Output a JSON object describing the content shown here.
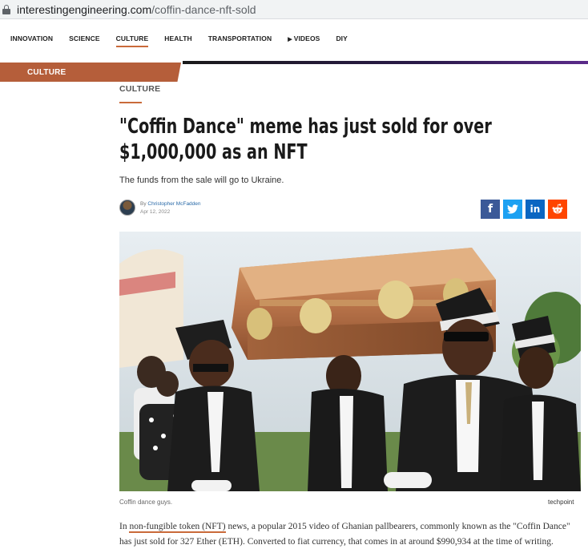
{
  "browser": {
    "url_domain": "interestingengineering.com",
    "url_path": "/coffin-dance-nft-sold"
  },
  "nav": {
    "items": [
      "INNOVATION",
      "SCIENCE",
      "CULTURE",
      "HEALTH",
      "TRANSPORTATION",
      "VIDEOS",
      "DIY"
    ],
    "active": "CULTURE"
  },
  "banner": {
    "label": "CULTURE"
  },
  "article": {
    "category": "CULTURE",
    "headline": "\"Coffin Dance\" meme has just sold for over $1,000,000 as an NFT",
    "subheadline": "The funds from the sale will go to Ukraine.",
    "by_prefix": "By",
    "author": "Christopher McFadden",
    "date": "Apr 12, 2022",
    "image_caption": "Coffin dance guys.",
    "image_credit": "techpoint",
    "body_before_link": "In ",
    "body_link": "non-fungible token (NFT)",
    "body_after_link": " news, a popular 2015 video of Ghanian pallbearers, commonly known as the \"Coffin Dance\" has just sold for 327 Ether (ETH). Converted to fiat currency, that comes in at around $990,934 at the time of writing."
  },
  "share": {
    "icons": [
      "facebook-icon",
      "twitter-icon",
      "linkedin-icon",
      "reddit-icon"
    ],
    "colors": {
      "facebook": "#3b5998",
      "twitter": "#1da1f2",
      "linkedin": "#0a66c2",
      "reddit": "#ff4500"
    }
  },
  "colors": {
    "accent": "#c96a3a",
    "banner": "#b55e3a",
    "author_link": "#2a6aa8"
  }
}
